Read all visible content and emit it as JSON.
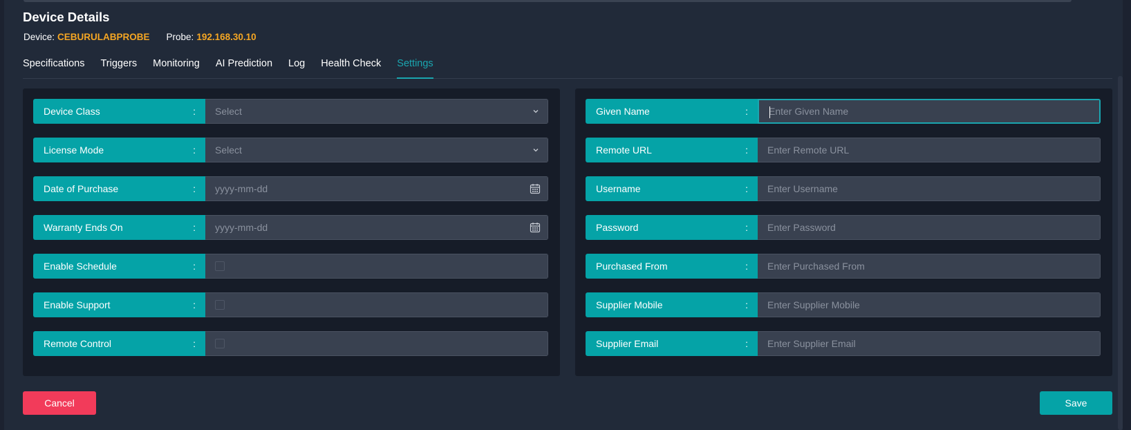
{
  "header": {
    "title": "Device Details",
    "device_label": "Device:",
    "device_value": "CEBURULABPROBE",
    "probe_label": "Probe:",
    "probe_value": "192.168.30.10"
  },
  "tabs": [
    {
      "label": "Specifications",
      "active": false
    },
    {
      "label": "Triggers",
      "active": false
    },
    {
      "label": "Monitoring",
      "active": false
    },
    {
      "label": "AI Prediction",
      "active": false
    },
    {
      "label": "Log",
      "active": false
    },
    {
      "label": "Health Check",
      "active": false
    },
    {
      "label": "Settings",
      "active": true
    }
  ],
  "left_fields": [
    {
      "label": "Device Class",
      "separator": ":",
      "type": "select",
      "placeholder": "Select"
    },
    {
      "label": "License Mode",
      "separator": ":",
      "type": "select",
      "placeholder": "Select"
    },
    {
      "label": "Date of Purchase",
      "separator": ":",
      "type": "date",
      "placeholder": "yyyy-mm-dd"
    },
    {
      "label": "Warranty Ends On",
      "separator": ":",
      "type": "date",
      "placeholder": "yyyy-mm-dd"
    },
    {
      "label": "Enable Schedule",
      "separator": ":",
      "type": "checkbox",
      "checked": false
    },
    {
      "label": "Enable Support",
      "separator": ":",
      "type": "checkbox",
      "checked": false
    },
    {
      "label": "Remote Control",
      "separator": ":",
      "type": "checkbox",
      "checked": false
    }
  ],
  "right_fields": [
    {
      "label": "Given Name",
      "separator": ":",
      "placeholder": "Enter Given Name",
      "value": "",
      "focused": true
    },
    {
      "label": "Remote URL",
      "separator": ":",
      "placeholder": "Enter Remote URL",
      "value": ""
    },
    {
      "label": "Username",
      "separator": ":",
      "placeholder": "Enter Username",
      "value": ""
    },
    {
      "label": "Password",
      "separator": ":",
      "placeholder": "Enter Password",
      "value": ""
    },
    {
      "label": "Purchased From",
      "separator": ":",
      "placeholder": "Enter Purchased From",
      "value": ""
    },
    {
      "label": "Supplier Mobile",
      "separator": ":",
      "placeholder": "Enter Supplier Mobile",
      "value": ""
    },
    {
      "label": "Supplier Email",
      "separator": ":",
      "placeholder": "Enter Supplier Email",
      "value": ""
    }
  ],
  "actions": {
    "cancel_label": "Cancel",
    "save_label": "Save"
  },
  "colors": {
    "accent": "#05a3a7",
    "highlight": "#f5a623",
    "danger": "#f23b5a"
  },
  "icons": {
    "select_chevron": "chevron-down-icon",
    "date_picker": "calendar-icon"
  }
}
